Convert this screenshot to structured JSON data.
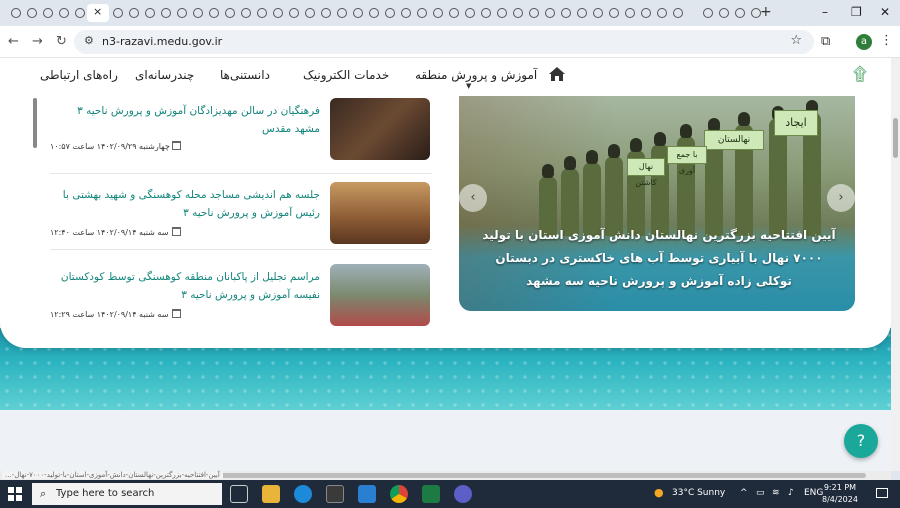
{
  "browser": {
    "active_tab_close": "×",
    "new_tab": "+",
    "window_controls": {
      "minimize": "–",
      "maximize": "❐",
      "close": "✕"
    },
    "url": "n3-razavi.medu.gov.ir",
    "profile_initial": "a"
  },
  "menu": {
    "items": [
      "آموزش و پرورش منطقه",
      "خدمات الکترونیک",
      "دانستنی‌ها",
      "چندرسانه‌ای",
      "راه‌های ارتباطی"
    ]
  },
  "slider": {
    "caption": "آیین افتتاحیه بزرگترین نهالستان دانش آموزی استان با تولید ۷۰۰۰ نهال با آبیاری توسط آب های خاکستری در دبستان توکلی زاده آموزش و پرورش ناحیه سه مشهد",
    "signs": [
      "ایجاد",
      "نهالستان",
      "با جمع آوری",
      "نهال کاشتن"
    ],
    "prev": "‹",
    "next": "›"
  },
  "news": [
    {
      "title": "فرهنگیان در سالن مهدیزادگان آموزش و پرورش ناحیه ۳ مشهد مقدس",
      "date": "چهارشنبه ۱۴۰۲/۰۹/۲۹ ساعت ۱۰:۵۷"
    },
    {
      "title": "جلسه هم اندیشی مساجد محله کوهسنگی و شهید بهشتی با رئیس آموزش و پرورش ناحیه ۳",
      "date": "سه شنبه ۱۴۰۲/۰۹/۱۴ ساعت ۱۲:۴۰"
    },
    {
      "title": "مراسم تجلیل از پاکبانان منطقه کوهسنگی توسط کودکستان نفیسه آموزش و پرورش ناحیه ۳",
      "date": "سه شنبه ۱۴۰۲/۰۹/۱۴ ساعت ۱۲:۲۹"
    }
  ],
  "status_hover": "آیین-افتتاحیه-بزرگترین-نهالستان-دانش-آموزی-استان-با-تولید-۷۰۰۰-نهال-...",
  "taskbar": {
    "search_placeholder": "Type here to search",
    "weather": "33°C  Sunny",
    "language": "ENG",
    "time": "9:21 PM",
    "date": "8/4/2024"
  },
  "colors": {
    "accent_teal": "#13857b",
    "help_button": "#1aa89a",
    "profile": "#2f7d3a"
  }
}
